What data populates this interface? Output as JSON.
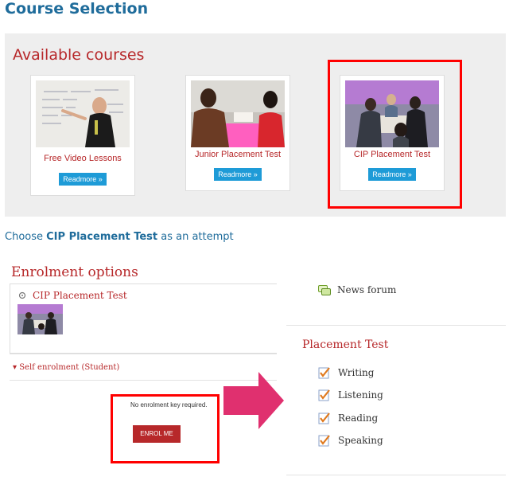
{
  "page_title": "Course Selection",
  "available": {
    "heading": "Available courses",
    "courses": [
      {
        "name": "Free Video Lessons",
        "button": "Readmore »"
      },
      {
        "name": "Junior Placement Test",
        "button": "Readmore »"
      },
      {
        "name": "CIP Placement Test",
        "button": "Readmore »"
      }
    ]
  },
  "choose": {
    "prefix": "Choose ",
    "course": "CIP Placement Test",
    "suffix": " as an attempt"
  },
  "enrolment": {
    "heading": "Enrolment options",
    "course_title": "CIP Placement Test",
    "self_enrolment": "Self enrolment (Student)",
    "no_key": "No enrolment key required.",
    "enrol_button": "ENROL ME"
  },
  "sidebar": {
    "news_forum": "News forum",
    "section_heading": "Placement Test",
    "activities": [
      "Writing",
      "Listening",
      "Reading",
      "Speaking"
    ]
  },
  "colors": {
    "brand_blue": "#1f6c9b",
    "accent_red": "#b7282a",
    "button_blue": "#1e9bd7",
    "highlight": "#ff0000",
    "arrow_pink": "#e0306f"
  }
}
